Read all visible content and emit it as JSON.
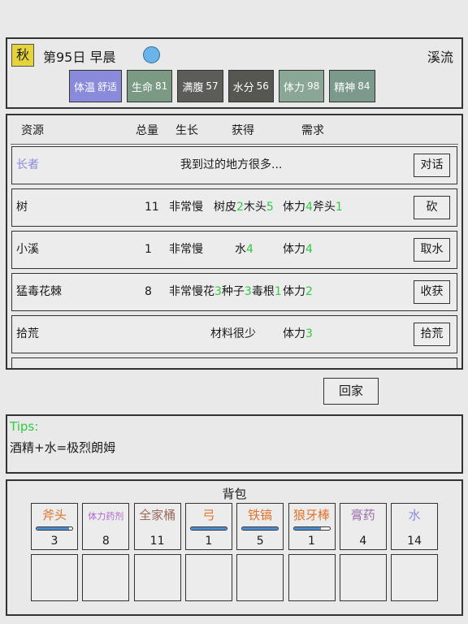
{
  "header": {
    "season": "秋",
    "day": "第95日 早晨",
    "weather_icon": "sun-icon",
    "location": "溪流",
    "stats": [
      {
        "label": "体温",
        "value": "舒适",
        "color": "#8a8adb"
      },
      {
        "label": "生命",
        "value": "81",
        "color": "#7a9a84"
      },
      {
        "label": "满腹",
        "value": "57",
        "color": "#5c5c58"
      },
      {
        "label": "水分",
        "value": "56",
        "color": "#575751"
      },
      {
        "label": "体力",
        "value": "98",
        "color": "#8aa796"
      },
      {
        "label": "精神",
        "value": "84",
        "color": "#7c9a8c"
      }
    ]
  },
  "table": {
    "headers": {
      "name": "资源",
      "total": "总量",
      "growth": "生长",
      "gain": "获得",
      "need": "需求"
    },
    "elder": {
      "name": "长者",
      "text": "我到过的地方很多...",
      "button": "对话",
      "color": "#8a8adb"
    },
    "rows": [
      {
        "name": "树",
        "total": "11",
        "growth": "非常慢",
        "gain": [
          [
            "树皮",
            "2"
          ],
          [
            "木头",
            "5"
          ]
        ],
        "need": [
          [
            "体力",
            "4"
          ],
          [
            "斧头",
            "1"
          ]
        ],
        "button": "砍"
      },
      {
        "name": "小溪",
        "total": "1",
        "growth": "非常慢",
        "gain": [
          [
            "水",
            "4"
          ]
        ],
        "need": [
          [
            "体力",
            "4"
          ]
        ],
        "button": "取水"
      },
      {
        "name": "猛毒花棘",
        "total": "8",
        "growth": "非常慢",
        "gain": [
          [
            "花",
            "3"
          ],
          [
            "种子",
            "3"
          ],
          [
            "毒根",
            "1"
          ]
        ],
        "need": [
          [
            "体力",
            "2"
          ]
        ],
        "button": "收获"
      },
      {
        "name": "拾荒",
        "total": "",
        "growth": "",
        "gain_text": "材料很少",
        "need": [
          [
            "体力",
            "3"
          ]
        ],
        "button": "拾荒"
      }
    ]
  },
  "home_button": "回家",
  "tips": {
    "title": "Tips:",
    "text": "酒精+水=极烈朗姆"
  },
  "bag": {
    "title": "背包",
    "items": [
      {
        "name": "斧头",
        "qty": "3",
        "color": "#e0742c",
        "durability": 0.92
      },
      {
        "name": "体力药剂",
        "qty": "8",
        "color": "#b06ad0"
      },
      {
        "name": "全家桶",
        "qty": "11",
        "color": "#9a6a5a"
      },
      {
        "name": "弓",
        "qty": "1",
        "color": "#e0742c",
        "durability": 1.0
      },
      {
        "name": "铁镐",
        "qty": "5",
        "color": "#e0742c",
        "durability": 1.0
      },
      {
        "name": "狼牙棒",
        "qty": "1",
        "color": "#e0742c",
        "durability": 0.75
      },
      {
        "name": "膏药",
        "qty": "4",
        "color": "#9a6aa8"
      },
      {
        "name": "水",
        "qty": "14",
        "color": "#8a8adb"
      }
    ],
    "empty_slots": 8
  }
}
